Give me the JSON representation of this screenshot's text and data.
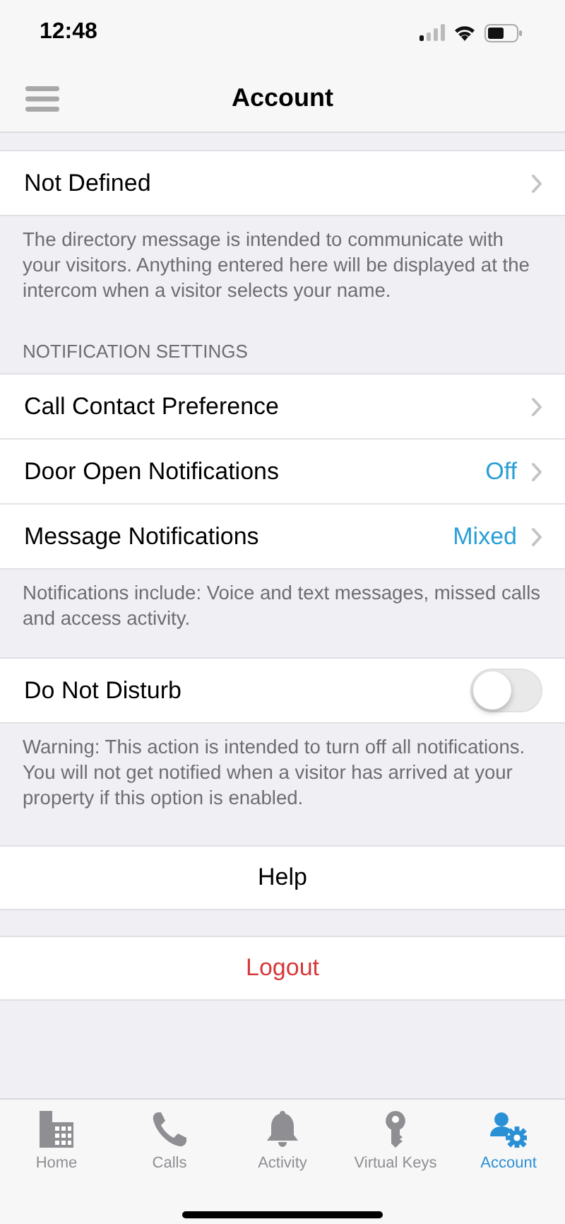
{
  "status_bar": {
    "time": "12:48"
  },
  "nav": {
    "title": "Account"
  },
  "sections": [
    {
      "kind": "group",
      "rows": [
        {
          "kind": "link",
          "label": "Not Defined"
        }
      ],
      "footer": "The directory message is intended to communicate with your visitors. Anything entered here will be displayed at the intercom when a visitor selects your name."
    },
    {
      "kind": "group",
      "header": "NOTIFICATION SETTINGS",
      "rows": [
        {
          "kind": "link",
          "label": "Call Contact Preference"
        },
        {
          "kind": "link",
          "label": "Door Open Notifications",
          "value": "Off"
        },
        {
          "kind": "link",
          "label": "Message Notifications",
          "value": "Mixed"
        }
      ],
      "footer": "Notifications include: Voice and text messages, missed calls and access activity."
    },
    {
      "kind": "group",
      "rows": [
        {
          "kind": "toggle",
          "label": "Do Not Disturb",
          "on": false
        }
      ],
      "footer": "Warning: This action is intended to turn off all notifications. You will not get notified when a visitor has arrived at your property if this option is enabled."
    },
    {
      "kind": "action",
      "label": "Help"
    },
    {
      "kind": "danger",
      "label": "Logout"
    }
  ],
  "tabs": [
    {
      "label": "Home",
      "selected": false
    },
    {
      "label": "Calls",
      "selected": false
    },
    {
      "label": "Activity",
      "selected": false
    },
    {
      "label": "Virtual Keys",
      "selected": false
    },
    {
      "label": "Account",
      "selected": true
    }
  ]
}
